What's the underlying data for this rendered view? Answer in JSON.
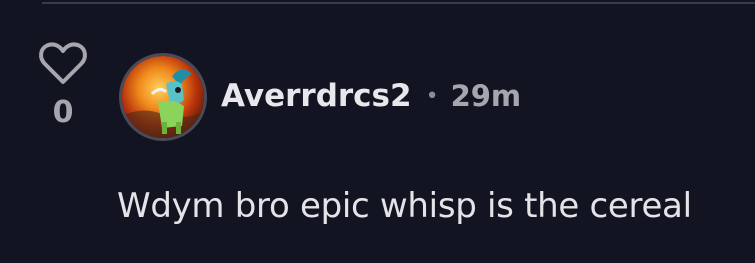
{
  "comment": {
    "like_count": "0",
    "author": "Averrdrcs2",
    "separator": "•",
    "time_ago": "29m",
    "text": "Wdym bro epic whisp is the cereal"
  },
  "icons": {
    "like": "heart-outline-icon",
    "avatar": "user-avatar-image"
  },
  "colors": {
    "background": "#131422",
    "text_primary": "#e8e8ec",
    "text_secondary": "#a6a7ae"
  }
}
